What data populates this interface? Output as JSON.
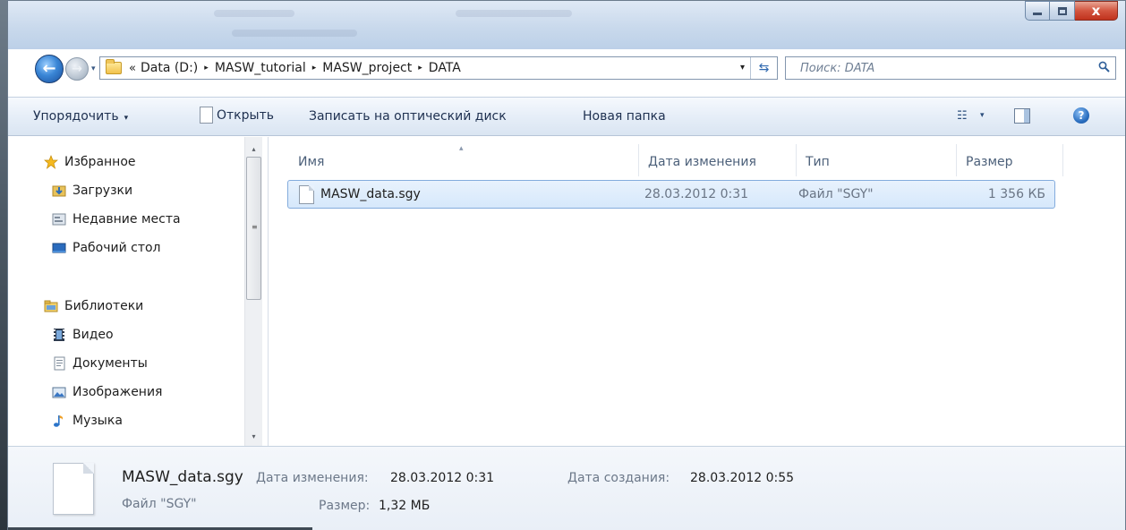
{
  "window": {
    "caption_minimize": "minimize-icon",
    "caption_maximize": "maximize-icon",
    "caption_close_glyph": "x"
  },
  "nav": {
    "back_glyph": "←",
    "forward_glyph": "→",
    "recent_glyph": "▾"
  },
  "address": {
    "overflow": "«",
    "crumbs": [
      "Data (D:)",
      "MASW_tutorial",
      "MASW_project",
      "DATA"
    ],
    "separator": "▸",
    "dropdown_glyph": "▾",
    "refresh_glyph": "⇆"
  },
  "search": {
    "placeholder": "Поиск: DATA"
  },
  "toolbar": {
    "organize": "Упорядочить",
    "organize_arrow": "▾",
    "open": "Открыть",
    "burn": "Записать на оптический диск",
    "new_folder": "Новая папка",
    "views_glyph": "☷",
    "views_arrow": "▾",
    "help_glyph": "?"
  },
  "sidebar": {
    "favorites": {
      "label": "Избранное",
      "items": [
        {
          "label": "Загрузки",
          "icon": "downloads-icon"
        },
        {
          "label": "Недавние места",
          "icon": "recent-places-icon"
        },
        {
          "label": "Рабочий стол",
          "icon": "desktop-icon"
        }
      ]
    },
    "libraries": {
      "label": "Библиотеки",
      "items": [
        {
          "label": "Видео",
          "icon": "video-icon"
        },
        {
          "label": "Документы",
          "icon": "documents-icon"
        },
        {
          "label": "Изображения",
          "icon": "pictures-icon"
        },
        {
          "label": "Музыка",
          "icon": "music-icon"
        }
      ]
    },
    "scroll_up": "▴",
    "scroll_down": "▾",
    "scroll_grip": "≡"
  },
  "columns": {
    "name": "Имя",
    "date": "Дата изменения",
    "type": "Тип",
    "size": "Размер",
    "sort_glyph": "▴"
  },
  "files": [
    {
      "name": "MASW_data.sgy",
      "date": "28.03.2012 0:31",
      "type": "Файл \"SGY\"",
      "size": "1 356 КБ"
    }
  ],
  "details": {
    "name": "MASW_data.sgy",
    "type": "Файл \"SGY\"",
    "modified_label": "Дата изменения:",
    "modified_value": "28.03.2012 0:31",
    "size_label": "Размер:",
    "size_value": "1,32 МБ",
    "created_label": "Дата создания:",
    "created_value": "28.03.2012 0:55"
  }
}
